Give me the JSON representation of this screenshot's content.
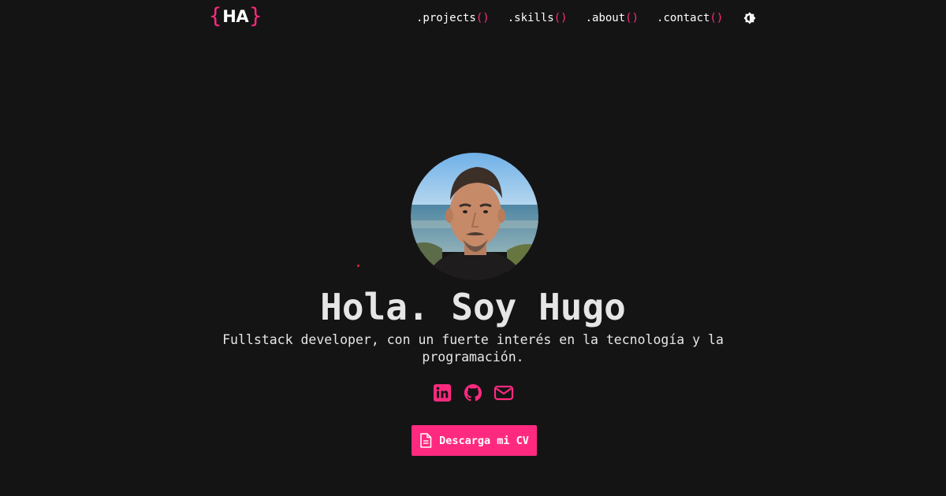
{
  "header": {
    "logo": {
      "open_brace": "{",
      "initials": "HA",
      "close_brace": "}"
    },
    "nav": [
      {
        "label": ".projects",
        "parens": "()"
      },
      {
        "label": ".skills",
        "parens": "()"
      },
      {
        "label": ".about",
        "parens": "()"
      },
      {
        "label": ".contact",
        "parens": "()"
      }
    ],
    "theme_toggle_icon": "brightness-icon"
  },
  "hero": {
    "avatar_icon": "profile-photo",
    "title": "Hola. Soy Hugo",
    "subtitle_line1": "Fullstack developer, con un fuerte interés en la tecnología y la",
    "subtitle_line2": "programación.",
    "socials": [
      {
        "icon": "linkedin-icon"
      },
      {
        "icon": "github-icon"
      },
      {
        "icon": "mail-icon"
      }
    ],
    "cv_button": {
      "icon": "document-icon",
      "label": "Descarga mi CV"
    }
  },
  "colors": {
    "background": "#151415",
    "accent": "#ff2a7f",
    "text": "#e6e6e6"
  }
}
